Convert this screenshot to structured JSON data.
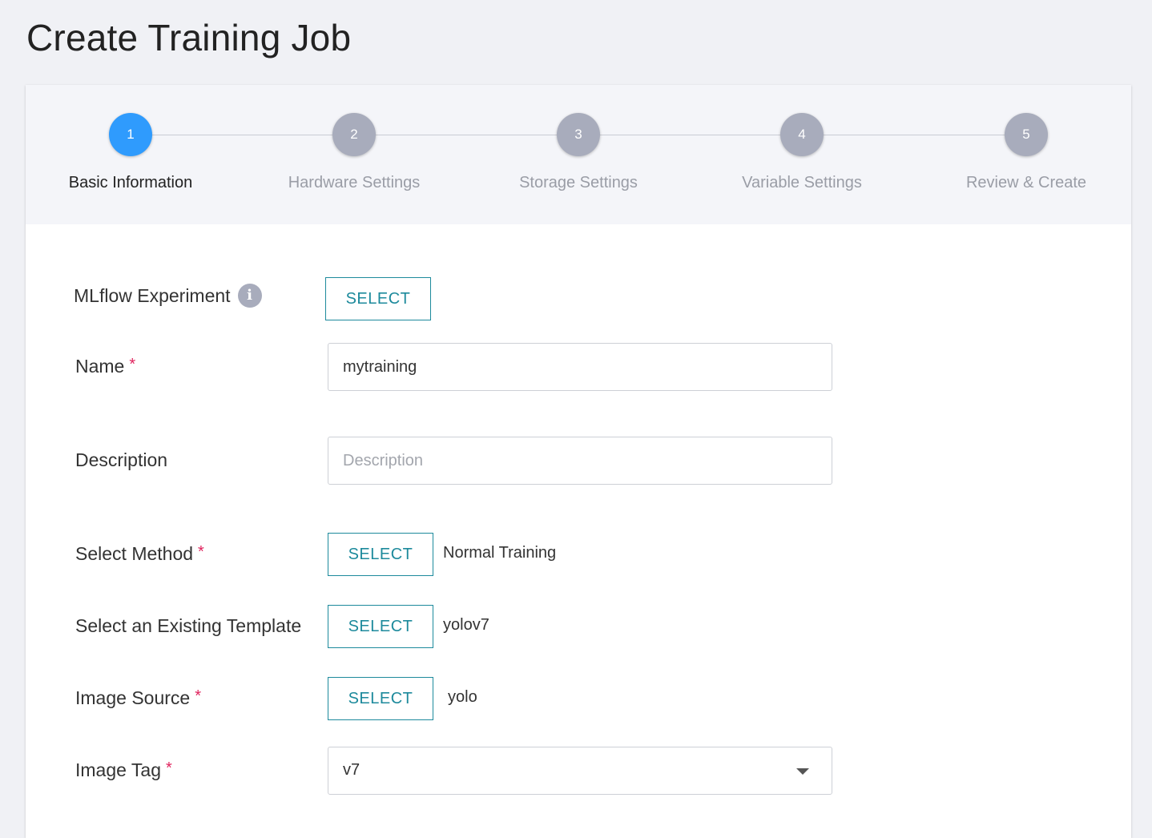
{
  "page": {
    "title": "Create Training Job"
  },
  "steps": [
    {
      "number": "1",
      "label": "Basic Information",
      "active": true
    },
    {
      "number": "2",
      "label": "Hardware Settings",
      "active": false
    },
    {
      "number": "3",
      "label": "Storage Settings",
      "active": false
    },
    {
      "number": "4",
      "label": "Variable Settings",
      "active": false
    },
    {
      "number": "5",
      "label": "Review & Create",
      "active": false
    }
  ],
  "form": {
    "mlflow": {
      "label": "MLflow Experiment",
      "info_icon": "info-icon",
      "button": "SELECT"
    },
    "name": {
      "label": "Name",
      "required": "*",
      "value": "mytraining"
    },
    "description": {
      "label": "Description",
      "placeholder": "Description",
      "value": ""
    },
    "method": {
      "label": "Select Method",
      "required": "*",
      "button": "SELECT",
      "value": "Normal Training"
    },
    "template": {
      "label": "Select an Existing Template",
      "button": "SELECT",
      "value": "yolov7"
    },
    "image_source": {
      "label": "Image Source",
      "required": "*",
      "button": "SELECT",
      "value": "yolo"
    },
    "image_tag": {
      "label": "Image Tag",
      "required": "*",
      "value": "v7",
      "dropdown_icon": "chevron-down-icon"
    }
  },
  "colors": {
    "accent": "#1d8a9c",
    "active_step": "#2f9bfd",
    "inactive_step": "#a8acbc",
    "required": "#e0245e"
  }
}
